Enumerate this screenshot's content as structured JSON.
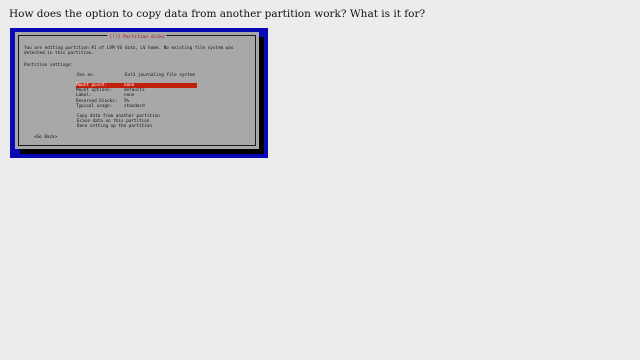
{
  "question": "How does the option to copy data from another partition work? What is it for?",
  "dialog": {
    "title": "[!!] Partition disks",
    "intro_lines": [
      "You are editing partition #1 of LVM VG data, LV home. No existing file system was",
      "detected in this partition."
    ],
    "settings_label": "Partition settings:",
    "use_as": {
      "label": "Use as:",
      "value": "Ext3 journaling file system"
    },
    "settings": [
      {
        "label": "Mount point:",
        "value": "none",
        "selected": true
      },
      {
        "label": "Mount options:",
        "value": "defaults",
        "selected": false
      },
      {
        "label": "Label:",
        "value": "none",
        "selected": false
      },
      {
        "label": "Reserved blocks:",
        "value": "5%",
        "selected": false
      },
      {
        "label": "Typical usage:",
        "value": "standard",
        "selected": false
      }
    ],
    "actions": [
      "Copy data from another partition",
      "Erase data on this partition",
      "Done setting up the partition"
    ],
    "go_back": "<Go Back>"
  },
  "colors": {
    "screen_background": "#0a0ab4",
    "dialog_background": "#a8a8a8",
    "title_color": "#b01010",
    "selection_highlight": "#c0200c"
  }
}
